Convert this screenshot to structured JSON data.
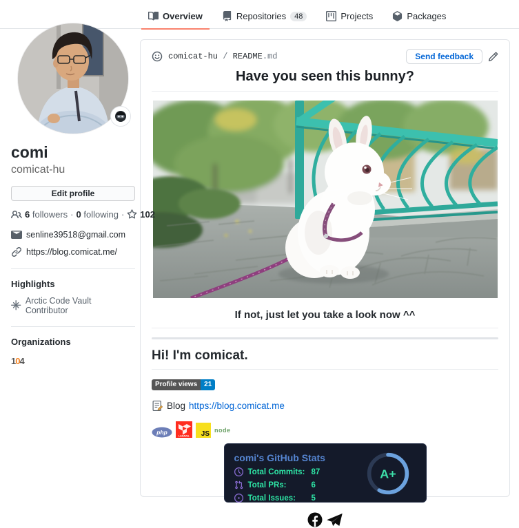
{
  "tabs": [
    {
      "label": "Overview",
      "active": true
    },
    {
      "label": "Repositories",
      "count": "48"
    },
    {
      "label": "Projects"
    },
    {
      "label": "Packages"
    }
  ],
  "profile": {
    "name": "comi",
    "username": "comicat-hu",
    "edit_button": "Edit profile",
    "followers_count": "6",
    "followers_word": "followers",
    "sep": "·",
    "following_count": "0",
    "following_word": "following",
    "stars_count": "102",
    "email": "senline39518@gmail.com",
    "website": "https://blog.comicat.me/",
    "highlights_title": "Highlights",
    "highlight_item": "Arctic Code Vault Contributor",
    "organizations_title": "Organizations",
    "org_name_parts": {
      "p1": "1",
      "p2": "0",
      "p3": "4"
    }
  },
  "readme": {
    "repo": "comicat-hu",
    "path_sep": " / ",
    "file_name": "README",
    "file_ext": ".md",
    "send_feedback": "Send feedback",
    "heading": "Have you seen this bunny?",
    "caption": "If not, just let you take a look now ^^",
    "greeting": "Hi! I'm comicat.",
    "views_label": "Profile views",
    "views_count": "21",
    "blog_label": "Blog",
    "blog_url": "https://blog.comicat.me",
    "tech": {
      "php": "php",
      "laravel": "LARAVEL",
      "js": "JS",
      "node": "node"
    }
  },
  "stats_card": {
    "title": "comi's GitHub Stats",
    "rows": [
      {
        "label": "Total Commits:",
        "value": "87"
      },
      {
        "label": "Total PRs:",
        "value": "6"
      },
      {
        "label": "Total Issues:",
        "value": "5"
      }
    ],
    "grade": "A+",
    "colors": {
      "bg": "#141a2a",
      "title": "#5585d1",
      "text": "#2ee6a6",
      "icon": "#8d6fd8",
      "ring": "#6ca2de",
      "ring_track": "#2c3a54"
    }
  },
  "icons": {
    "tab_active_underline": "#f9826c",
    "link_blue": "#0366d6",
    "social": [
      "facebook-icon",
      "telegram-icon"
    ]
  }
}
